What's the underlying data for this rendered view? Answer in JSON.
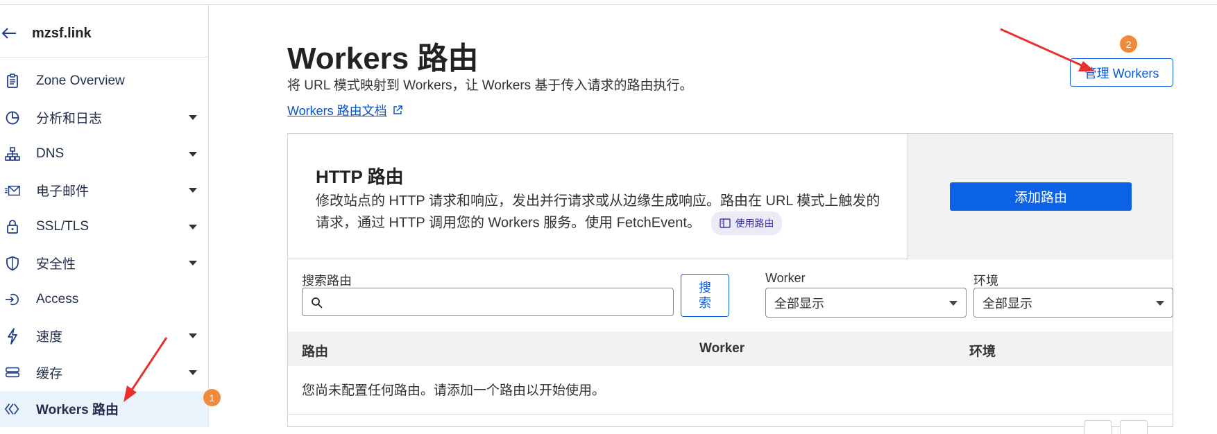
{
  "zone": {
    "name": "mzsf.link"
  },
  "sidebar": {
    "items": [
      {
        "label": "Zone Overview",
        "icon": "clipboard-icon",
        "has_caret": false
      },
      {
        "label": "分析和日志",
        "icon": "pie-chart-icon",
        "has_caret": true
      },
      {
        "label": "DNS",
        "icon": "network-icon",
        "has_caret": true
      },
      {
        "label": "电子邮件",
        "icon": "email-icon",
        "has_caret": true
      },
      {
        "label": "SSL/TLS",
        "icon": "lock-icon",
        "has_caret": true
      },
      {
        "label": "安全性",
        "icon": "shield-icon",
        "has_caret": true
      },
      {
        "label": "Access",
        "icon": "access-icon",
        "has_caret": false
      },
      {
        "label": "速度",
        "icon": "bolt-icon",
        "has_caret": true
      },
      {
        "label": "缓存",
        "icon": "storage-icon",
        "has_caret": true
      },
      {
        "label": "Workers 路由",
        "icon": "workers-icon",
        "has_caret": false,
        "active": true
      }
    ]
  },
  "main": {
    "title": "Workers 路由",
    "subtitle": "将 URL 模式映射到 Workers，让 Workers 基于传入请求的路由执行。",
    "doc_link": "Workers 路由文档",
    "manage_button": "管理 Workers"
  },
  "http_card": {
    "title": "HTTP 路由",
    "desc_line1": "修改站点的 HTTP 请求和响应，发出并行请求或从边缘生成响应。路由在 URL 模式上触发的",
    "desc_line2": "请求，通过 HTTP 调用您的 Workers 服务。使用 FetchEvent。",
    "badge": "使用路由",
    "add_button": "添加路由"
  },
  "filters": {
    "search_label": "搜索路由",
    "search_value": "",
    "search_button": "搜\n索",
    "worker_label": "Worker",
    "worker_selected": "全部显示",
    "env_label": "环境",
    "env_selected": "全部显示"
  },
  "table": {
    "columns": [
      "路由",
      "Worker",
      "环境"
    ],
    "empty_message": "您尚未配置任何路由。请添加一个路由以开始使用。"
  },
  "annotations": {
    "marker1": "1",
    "marker2": "2",
    "color": "#f08a3a",
    "arrow_color": "#e8312f"
  }
}
